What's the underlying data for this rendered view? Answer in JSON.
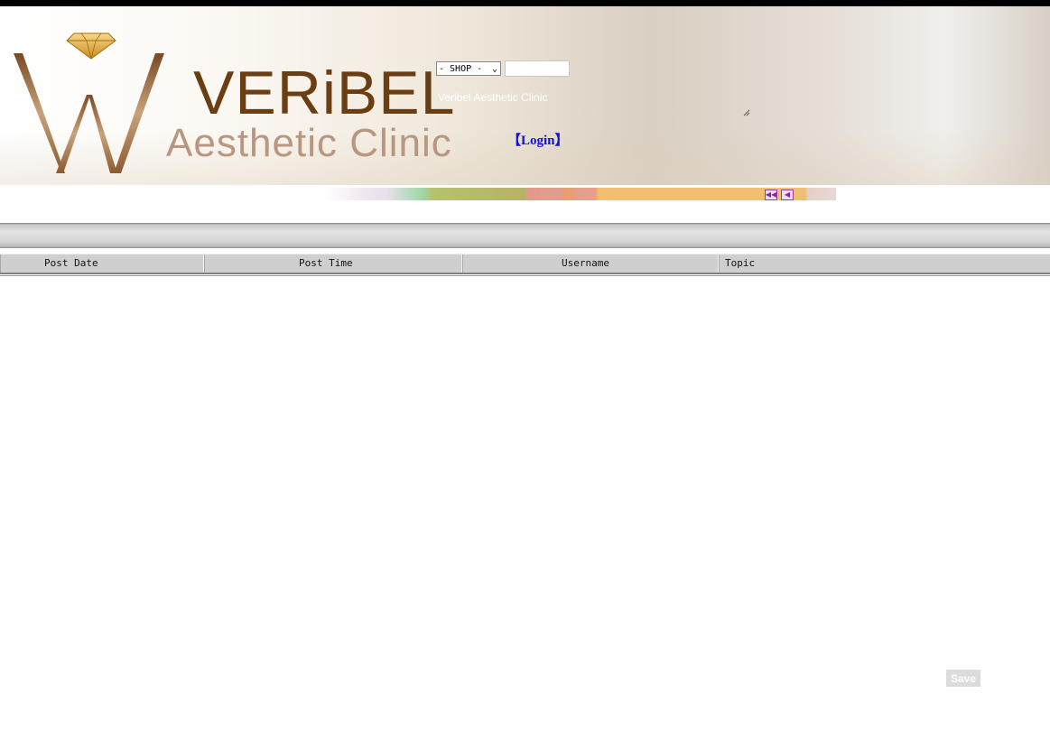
{
  "header": {
    "brand_name": "VERiBEL",
    "brand_sub": "Aesthetic Clinic",
    "shop_select": {
      "selected": "- SHOP -"
    },
    "shop_input": {
      "value": ""
    },
    "clinic_caption": "Veribel Aesthetic Clinic",
    "login_label": "【Login】"
  },
  "pager": {
    "first_icon": "first-page-icon",
    "prev_icon": "prev-page-icon"
  },
  "table": {
    "columns": [
      "Post Date",
      "Post Time",
      "Username",
      "Topic"
    ],
    "rows": []
  },
  "footer": {
    "save_label": "Save"
  },
  "colors": {
    "brand_brown": "#6b3d12",
    "brand_tan": "#b89680",
    "link_blue": "#1010e0",
    "diamond_gold": "#e8b84a"
  }
}
